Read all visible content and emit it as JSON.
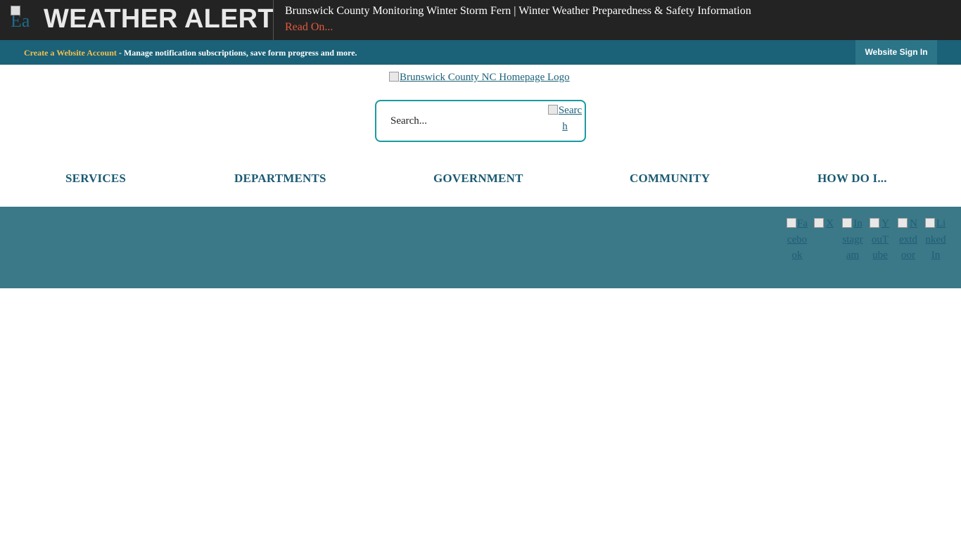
{
  "alert": {
    "icon": "alert-icon",
    "icon_alt_fragment": "Ea",
    "title": "WEATHER ALERT",
    "headline": "Brunswick County Monitoring Winter Storm Fern | Winter Weather Preparedness & Safety Information",
    "read_on": "Read On..."
  },
  "account_bar": {
    "create_link": "Create a Website Account",
    "description": " - Manage notification subscriptions, save form progress and more.",
    "sign_in": "Website Sign In"
  },
  "logo": {
    "alt": "Brunswick County NC Homepage Logo"
  },
  "search": {
    "placeholder": "Search...",
    "button_alt": "Search"
  },
  "nav": [
    {
      "label": "SERVICES"
    },
    {
      "label": "DEPARTMENTS"
    },
    {
      "label": "GOVERNMENT"
    },
    {
      "label": "COMMUNITY"
    },
    {
      "label": "HOW DO I..."
    }
  ],
  "social": [
    {
      "label": "Facebook",
      "icon": "facebook-icon"
    },
    {
      "label": "X",
      "icon": "x-icon"
    },
    {
      "label": "Instagram",
      "icon": "instagram-icon"
    },
    {
      "label": "YouTube",
      "icon": "youtube-icon"
    },
    {
      "label": "Nextdoor",
      "icon": "nextdoor-icon"
    },
    {
      "label": "LinkedIn",
      "icon": "linkedin-icon"
    }
  ],
  "colors": {
    "alert_bg": "#232323",
    "account_bar_bg": "#1b6178",
    "accent_link": "#f2c14e",
    "read_on": "#e0593c",
    "search_border": "#1a9aa0",
    "social_band_bg": "#3b7888"
  }
}
